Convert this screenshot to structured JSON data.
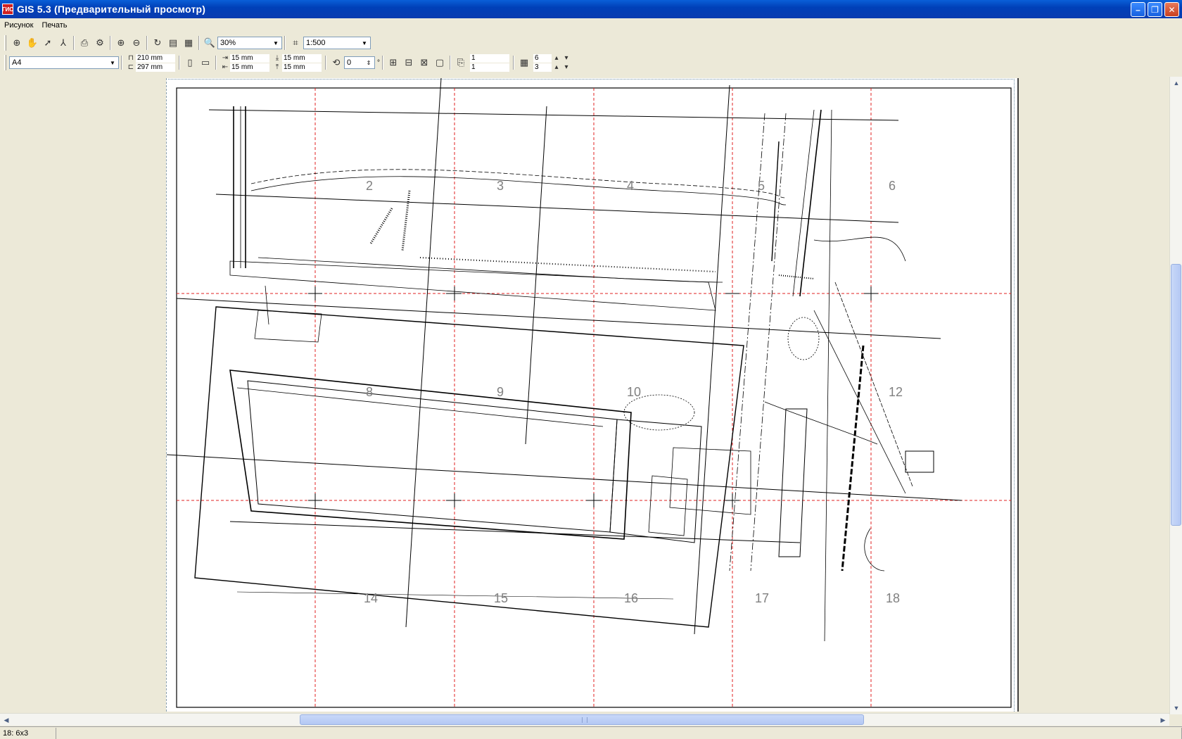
{
  "window": {
    "title": "GIS 5.3 (Предварительный просмотр)",
    "icon_text": "ГИС"
  },
  "menu": [
    "Рисунок",
    "Печать"
  ],
  "toolbar1": {
    "zoom_value": "30%",
    "scale_value": "1:500"
  },
  "toolbar2": {
    "paper_format": "A4",
    "paper_width": "210 mm",
    "paper_height": "297 mm",
    "margin_left": "15 mm",
    "margin_right": "15 mm",
    "margin_top": "15 mm",
    "margin_bottom": "15 mm",
    "rotation": "0",
    "rotation_unit": "°",
    "pages_h": "1",
    "pages_v": "1",
    "cols": "6",
    "rows": "3"
  },
  "map": {
    "sheet_numbers": [
      {
        "n": "2"
      },
      {
        "n": "3"
      },
      {
        "n": "4"
      },
      {
        "n": "5"
      },
      {
        "n": "6"
      },
      {
        "n": "8"
      },
      {
        "n": "9"
      },
      {
        "n": "10"
      },
      {
        "n": "12"
      },
      {
        "n": "14"
      },
      {
        "n": "15"
      },
      {
        "n": "16"
      },
      {
        "n": "17"
      },
      {
        "n": "18"
      }
    ]
  },
  "status": {
    "text": "18: 6x3"
  },
  "icons": [
    "zoom-fit-icon",
    "hand-pan-icon",
    "select-arrow-icon",
    "measure-icon",
    "print-icon",
    "print-setup-icon",
    "zoom-in-icon",
    "zoom-out-icon",
    "refresh-icon",
    "page-setup-icon",
    "page-layout-icon"
  ]
}
